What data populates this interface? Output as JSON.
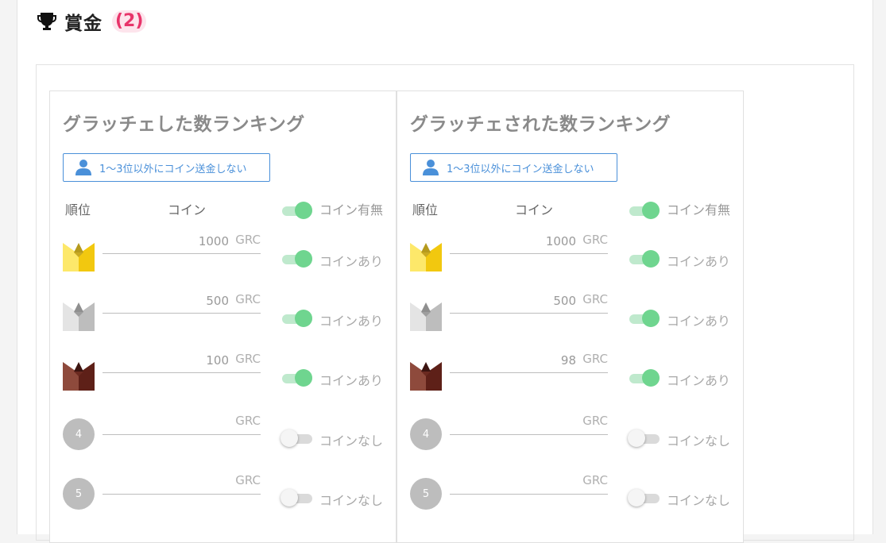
{
  "header": {
    "title": "賞金",
    "count": "(2)",
    "icon": "trophy-icon"
  },
  "colors": {
    "accent": "#4a90d9",
    "toggle_on": "#6fd58f",
    "count": "#e8346a"
  },
  "panels": [
    {
      "title": "グラッチェした数ランキング",
      "button_label": "1〜3位以外にコイン送金しない",
      "col_rank": "順位",
      "col_coin": "コイン",
      "col_flag": "コイン有無",
      "rows": [
        {
          "rank_icon": "gold-crown-icon",
          "value": "1000",
          "unit": "GRC",
          "on": true,
          "label": "コインあり"
        },
        {
          "rank_icon": "silver-crown-icon",
          "value": "500",
          "unit": "GRC",
          "on": true,
          "label": "コインあり"
        },
        {
          "rank_icon": "bronze-crown-icon",
          "value": "100",
          "unit": "GRC",
          "on": true,
          "label": "コインあり"
        },
        {
          "rank": "4",
          "value": "",
          "unit": "GRC",
          "on": false,
          "label": "コインなし"
        },
        {
          "rank": "5",
          "value": "",
          "unit": "GRC",
          "on": false,
          "label": "コインなし"
        }
      ]
    },
    {
      "title": "グラッチェされた数ランキング",
      "button_label": "1〜3位以外にコイン送金しない",
      "col_rank": "順位",
      "col_coin": "コイン",
      "col_flag": "コイン有無",
      "rows": [
        {
          "rank_icon": "gold-crown-icon",
          "value": "1000",
          "unit": "GRC",
          "on": true,
          "label": "コインあり"
        },
        {
          "rank_icon": "silver-crown-icon",
          "value": "500",
          "unit": "GRC",
          "on": true,
          "label": "コインあり"
        },
        {
          "rank_icon": "bronze-crown-icon",
          "value": "98",
          "unit": "GRC",
          "on": true,
          "label": "コインあり"
        },
        {
          "rank": "4",
          "value": "",
          "unit": "GRC",
          "on": false,
          "label": "コインなし"
        },
        {
          "rank": "5",
          "value": "",
          "unit": "GRC",
          "on": false,
          "label": "コインなし"
        }
      ]
    }
  ]
}
